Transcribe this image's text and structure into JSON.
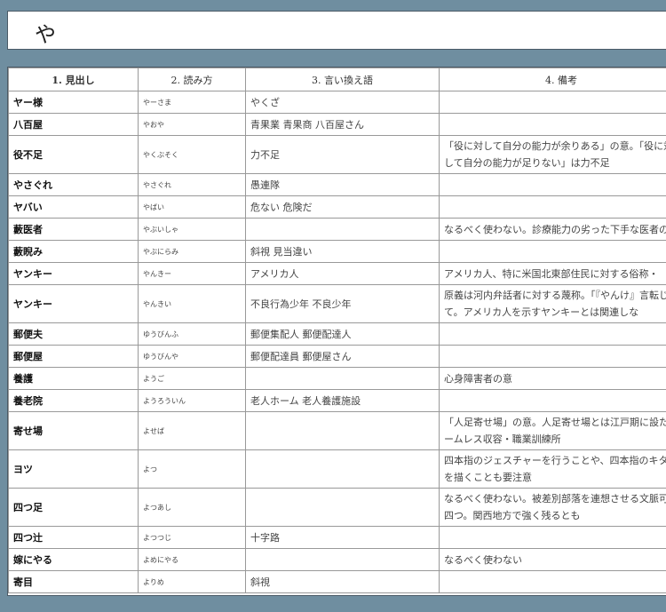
{
  "title": "や",
  "headers": [
    "1. 見出し",
    "2. 読み方",
    "3. 言い換え語",
    "4. 備考"
  ],
  "rows": [
    {
      "midashi": "ヤー様",
      "yomi": "やーさま",
      "iikae": "やくざ",
      "biko": ""
    },
    {
      "midashi": "八百屋",
      "yomi": "やおや",
      "iikae": "青果業 青果商 八百屋さん",
      "biko": ""
    },
    {
      "midashi": "役不足",
      "yomi": "やくぶそく",
      "iikae": "力不足",
      "biko": "「役に対して自分の能力が余りある」の意。「役に対して自分の能力が足りない」は力不足"
    },
    {
      "midashi": "やさぐれ",
      "yomi": "やさぐれ",
      "iikae": "愚連隊",
      "biko": ""
    },
    {
      "midashi": "ヤバい",
      "yomi": "やばい",
      "iikae": "危ない 危険だ",
      "biko": ""
    },
    {
      "midashi": "藪医者",
      "yomi": "やぶいしゃ",
      "iikae": "",
      "biko": "なるべく使わない。診療能力の劣った下手な医者の"
    },
    {
      "midashi": "藪睨み",
      "yomi": "やぶにらみ",
      "iikae": "斜視 見当違い",
      "biko": ""
    },
    {
      "midashi": "ヤンキー",
      "yomi": "やんきー",
      "iikae": "アメリカ人",
      "biko": "アメリカ人、特に米国北東部住民に対する俗称・"
    },
    {
      "midashi": "ヤンキー",
      "yomi": "やんきい",
      "iikae": "不良行為少年 不良少年",
      "biko": "原義は河内弁話者に対する蔑称。「『やんけ』言転じて。アメリカ人を示すヤンキーとは関連しな"
    },
    {
      "midashi": "郵便夫",
      "yomi": "ゆうびんふ",
      "iikae": "郵便集配人 郵便配達人",
      "biko": ""
    },
    {
      "midashi": "郵便屋",
      "yomi": "ゆうびんや",
      "iikae": "郵便配達員 郵便屋さん",
      "biko": ""
    },
    {
      "midashi": "養護",
      "yomi": "ようご",
      "iikae": "",
      "biko": "心身障害者の意"
    },
    {
      "midashi": "養老院",
      "yomi": "ようろういん",
      "iikae": "老人ホーム 老人養護施設",
      "biko": ""
    },
    {
      "midashi": "寄せ場",
      "yomi": "よせば",
      "iikae": "",
      "biko": "「人足寄せ場」の意。人足寄せ場とは江戸期に設たホームレス収容・職業訓練所"
    },
    {
      "midashi": "ヨツ",
      "yomi": "よつ",
      "iikae": "",
      "biko": "四本指のジェスチャーを行うことや、四本指のキターを描くことも要注意"
    },
    {
      "midashi": "四つ足",
      "yomi": "よつあし",
      "iikae": "",
      "biko": "なるべく使わない。被差別部落を連想させる文脈可。四つ。関西地方で強く残るとも"
    },
    {
      "midashi": "四つ辻",
      "yomi": "よつつじ",
      "iikae": "十字路",
      "biko": ""
    },
    {
      "midashi": "嫁にやる",
      "yomi": "よめにやる",
      "iikae": "",
      "biko": "なるべく使わない"
    },
    {
      "midashi": "寄目",
      "yomi": "よりめ",
      "iikae": "斜視",
      "biko": ""
    }
  ]
}
